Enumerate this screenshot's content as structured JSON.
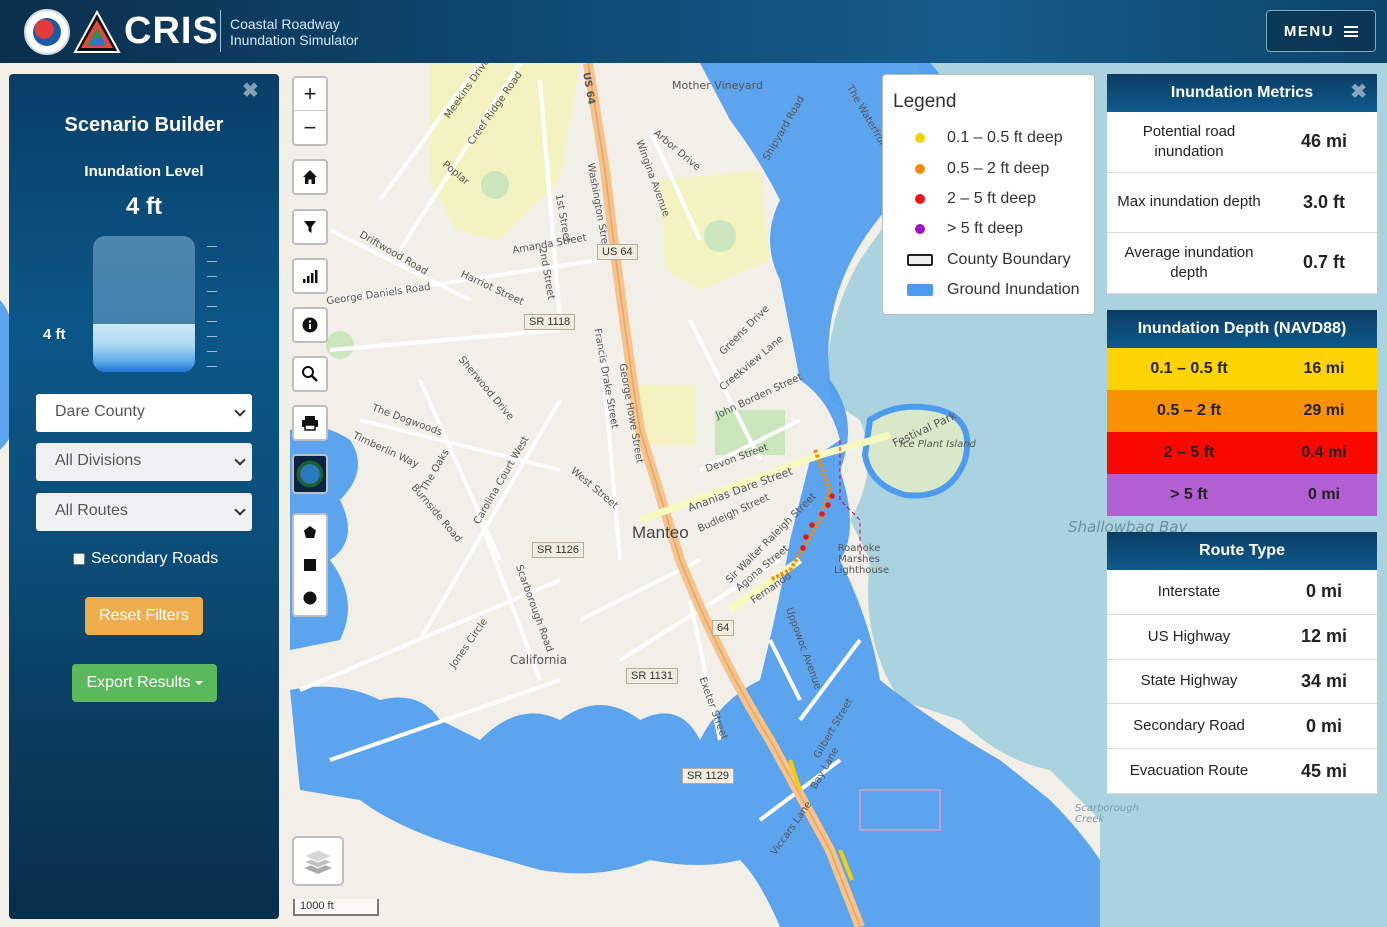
{
  "header": {
    "brand": "CRIS",
    "subtitle_line1": "Coastal Roadway",
    "subtitle_line2": "Inundation Simulator",
    "menu_label": "MENU"
  },
  "builder": {
    "title": "Scenario Builder",
    "level_label": "Inundation Level",
    "level_value": "4 ft",
    "gauge_marker": "4 ft",
    "gauge_fraction": 0.35,
    "county": "Dare County",
    "division": "All Divisions",
    "route": "All Routes",
    "secondary_label": "Secondary Roads",
    "secondary_checked": false,
    "reset_label": "Reset Filters",
    "export_label": "Export Results"
  },
  "map": {
    "town": "Manteo",
    "scale": "1000 ft",
    "labels": [
      "Meekins Drive",
      "Creef Ridge Road",
      "Poplar",
      "Mother Vineyard",
      "Shipyard Road",
      "US 64",
      "Driftwood Road",
      "George Daniels Road",
      "Harriot Street",
      "Amanda Street",
      "2nd Street",
      "1st Street",
      "Washington Street",
      "Wingina Avenue",
      "Ananias Dare Street",
      "Budleigh Street",
      "Sir Walter Raleigh Street",
      "Agona Street",
      "Fernando",
      "Festival Park",
      "Ice Plant Island",
      "Roanoke Marshes Lighthouse",
      "Shallowbag Bay",
      "The Dogwoods",
      "Sherwood Drive",
      "Timberlin Way",
      "The Oaks",
      "Carolina Court West",
      "West Street",
      "Devon Street",
      "John Borden Street",
      "Creekview Lane",
      "Greens Drive",
      "Francis Drake Street",
      "George Howe Street",
      "Burnside Road",
      "California",
      "Jones Circle",
      "Scarborough Road",
      "Exeter Street",
      "Uppowoc Avenue",
      "Gilbert Street",
      "Bay Lane",
      "Viccars Lane",
      "Scarborough Creek",
      "Arbor Drive",
      "The Waterfront"
    ],
    "shields": [
      "US 64",
      "SR 1118",
      "SR 1126",
      "SR 1131",
      "SR 1129",
      "64"
    ]
  },
  "legend": {
    "title": "Legend",
    "items": [
      {
        "label": "0.1 – 0.5 ft deep",
        "color": "#f5d000",
        "kind": "dot"
      },
      {
        "label": "0.5 – 2 ft deep",
        "color": "#f48a0c",
        "kind": "dot"
      },
      {
        "label": "2 – 5 ft deep",
        "color": "#e8161b",
        "kind": "dot"
      },
      {
        "label": "> 5 ft deep",
        "color": "#9b12c8",
        "kind": "dot"
      },
      {
        "label": "County Boundary",
        "color": "#222222",
        "kind": "box"
      },
      {
        "label": "Ground Inundation",
        "color": "#4d9bef",
        "kind": "fill"
      }
    ]
  },
  "metrics": {
    "title": "Inundation Metrics",
    "rows": [
      {
        "label": "Potential road inundation",
        "value": "46 mi"
      },
      {
        "label": "Max inundation depth",
        "value": "3.0 ft"
      },
      {
        "label": "Average inundation depth",
        "value": "0.7 ft"
      }
    ]
  },
  "depth": {
    "title": "Inundation Depth (NAVD88)",
    "rows": [
      {
        "label": "0.1 – 0.5 ft",
        "value": "16 mi",
        "color": "#fdd400"
      },
      {
        "label": "0.5 – 2 ft",
        "value": "29 mi",
        "color": "#f99200"
      },
      {
        "label": "2 – 5 ft",
        "value": "0.4 mi",
        "color": "#fa0800"
      },
      {
        "label": "> 5 ft",
        "value": "0 mi",
        "color": "#b25fd4"
      }
    ]
  },
  "route_type": {
    "title": "Route Type",
    "rows": [
      {
        "label": "Interstate",
        "value": "0 mi"
      },
      {
        "label": "US Highway",
        "value": "12 mi"
      },
      {
        "label": "State Highway",
        "value": "34 mi"
      },
      {
        "label": "Secondary Road",
        "value": "0 mi"
      },
      {
        "label": "Evacuation Route",
        "value": "45 mi"
      }
    ]
  }
}
